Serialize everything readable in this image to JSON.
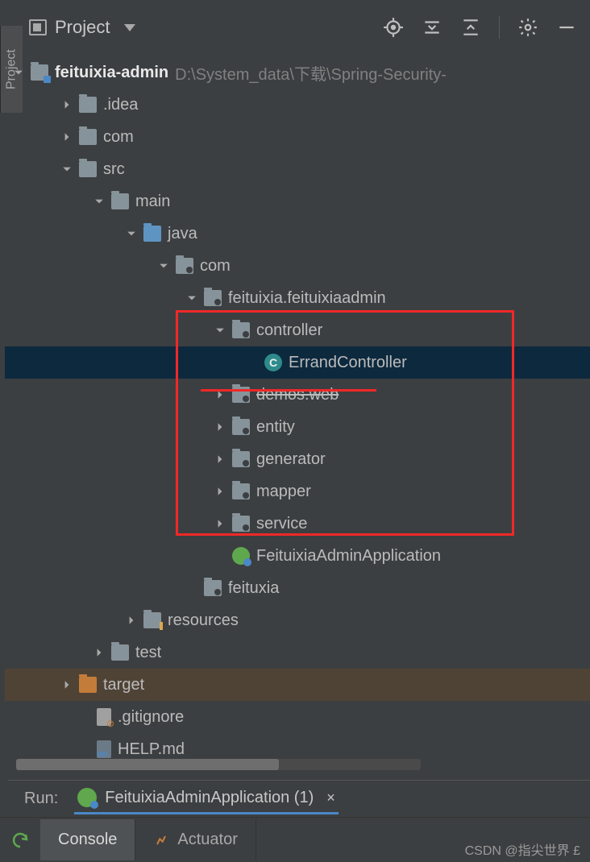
{
  "sidebar_tab": "Project",
  "toolbar": {
    "title": "Project"
  },
  "tree": {
    "root": {
      "name": "feituixia-admin",
      "path": "D:\\System_data\\下载\\Spring-Security-"
    },
    "idea": ".idea",
    "com_top": "com",
    "src": "src",
    "main": "main",
    "java": "java",
    "com": "com",
    "pkg": "feituixia.feituixiaadmin",
    "controller": "controller",
    "errand": "ErrandController",
    "demos": "demos.web",
    "entity": "entity",
    "generator": "generator",
    "mapper": "mapper",
    "service": "service",
    "app": "FeituixiaAdminApplication",
    "feituxia": "feituxia",
    "resources": "resources",
    "test": "test",
    "target": "target",
    "gitignore": ".gitignore",
    "helpmd": "HELP.md"
  },
  "run": {
    "label": "Run:",
    "tab": "FeituixiaAdminApplication (1)"
  },
  "bottom_tabs": {
    "console": "Console",
    "actuator": "Actuator"
  },
  "watermark": "CSDN @指尖世界  £"
}
